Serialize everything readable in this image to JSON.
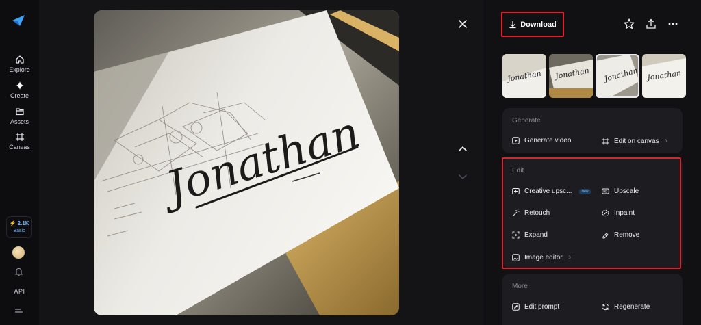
{
  "rail": {
    "items": [
      {
        "label": "Explore",
        "icon": "home-icon"
      },
      {
        "label": "Create",
        "icon": "sparkle-icon"
      },
      {
        "label": "Assets",
        "icon": "folder-icon"
      },
      {
        "label": "Canvas",
        "icon": "canvas-icon"
      }
    ],
    "credits": {
      "amount": "2.1K",
      "plan": "Basic"
    },
    "api_label": "API"
  },
  "image": {
    "signature_text": "Jonathan"
  },
  "panel": {
    "download_label": "Download",
    "generate": {
      "title": "Generate",
      "actions": [
        {
          "label": "Generate video",
          "icon": "play-icon"
        },
        {
          "label": "Edit on canvas",
          "icon": "canvas-icon",
          "has_chevron": true
        }
      ]
    },
    "edit": {
      "title": "Edit",
      "actions": [
        {
          "label": "Creative upsc...",
          "icon": "upscale-creative-icon",
          "badge": "New"
        },
        {
          "label": "Upscale",
          "icon": "hd-icon"
        },
        {
          "label": "Retouch",
          "icon": "wand-icon"
        },
        {
          "label": "Inpaint",
          "icon": "inpaint-icon"
        },
        {
          "label": "Expand",
          "icon": "expand-icon"
        },
        {
          "label": "Remove",
          "icon": "eraser-icon"
        },
        {
          "label": "Image editor",
          "icon": "image-edit-icon",
          "has_chevron": true
        }
      ]
    },
    "more": {
      "title": "More",
      "actions": [
        {
          "label": "Edit prompt",
          "icon": "pencil-box-icon"
        },
        {
          "label": "Regenerate",
          "icon": "refresh-icon"
        }
      ]
    }
  },
  "colors": {
    "accent": "#6fb4ff",
    "highlight_frame": "#d8242c",
    "background": "#0d0d10"
  }
}
